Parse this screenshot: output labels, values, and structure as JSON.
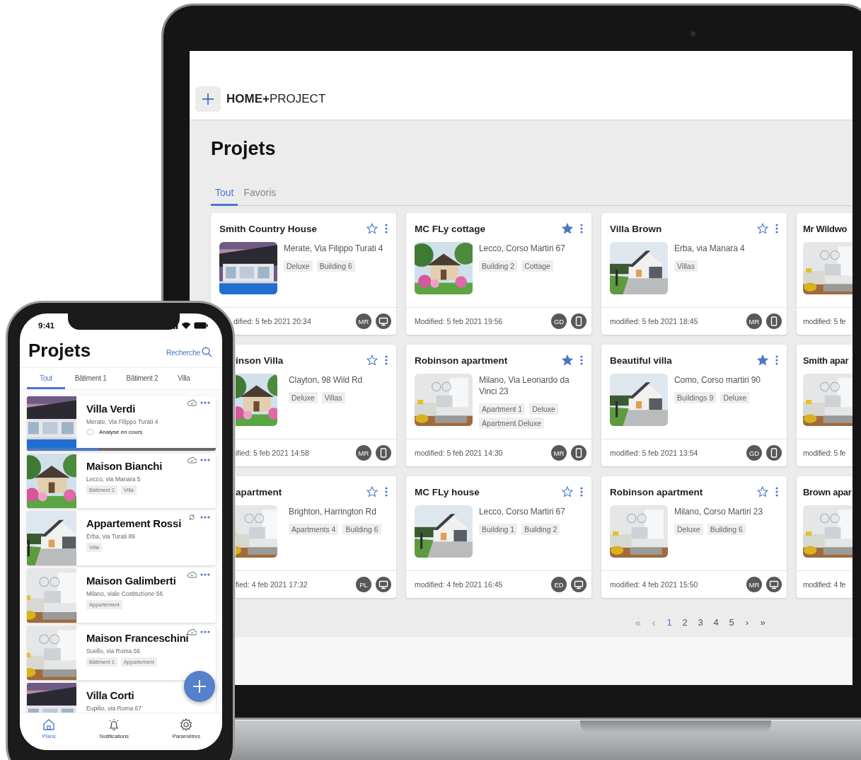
{
  "laptop": {
    "brand": "**HOME+**PROJECT",
    "page_title": "Projets",
    "tabs": [
      {
        "label": "Tout",
        "selected": true
      },
      {
        "label": "Favoris",
        "selected": false
      }
    ],
    "cards": [
      {
        "title": "Smith Country House",
        "favorite": false,
        "address": "Merate, Via Filippo Turati 4",
        "tags": [
          "Deluxe",
          "Building 6"
        ],
        "modified": "dified: 5 feb 2021 20:34",
        "avatar": "MR",
        "device": {
          "kind": "desktop"
        }
      },
      {
        "title": "MC FLy cottage",
        "favorite": true,
        "address": "Lecco, Corso Martiri 67",
        "tags": [
          "Building 2",
          "Cottage"
        ],
        "modified": "Modified: 5 feb 2021 19:56",
        "avatar": "GD",
        "device": {
          "kind": "phone"
        }
      },
      {
        "title": "Villa Brown",
        "favorite": false,
        "address": "Erba, via Manara 4",
        "tags": [
          "Villas"
        ],
        "modified": "modified: 5 feb 2021 18:45",
        "avatar": "MR",
        "device": {
          "kind": "phone"
        }
      },
      {
        "title": "Mr Wildwo",
        "modified": "modified: 5 fe"
      },
      {
        "title": "inson Villa",
        "favorite": false,
        "address": "Clayton, 98 Wild Rd",
        "tags": [
          "Deluxe",
          "Villas"
        ],
        "modified": "ified: 5 feb 2021 14:58",
        "avatar": "MR",
        "device": {
          "kind": "phone"
        }
      },
      {
        "title": "Robinson apartment",
        "favorite": true,
        "address": "Milano, Via Leonardo da Vinci 23",
        "tags": [
          "Apartment 1",
          "Deluxe",
          "Apartment Deluxe"
        ],
        "modified": "modified: 5 feb 2021 14:30",
        "avatar": "MR",
        "device": {
          "kind": "phone"
        }
      },
      {
        "title": "Beautiful villa",
        "favorite": true,
        "address": "Como, Corso martiri 90",
        "tags": [
          "Buildings 9",
          "Deluxe"
        ],
        "modified": "modified: 5 feb 2021 13:54",
        "avatar": "GD",
        "device": {
          "kind": "phone"
        }
      },
      {
        "title": "Smith apar",
        "modified": "modified: 5 fe"
      },
      {
        "title": "apartment",
        "favorite": false,
        "address": "Brighton, Harrington Rd",
        "tags": [
          "Apartments 4",
          "Building 6"
        ],
        "modified": "fied: 4 feb 2021 17:32",
        "avatar": "PL",
        "device": {
          "kind": "desktop"
        }
      },
      {
        "title": "MC FLy house",
        "favorite": false,
        "address": "Lecco, Corso Martiri 67",
        "tags": [
          "Building 1",
          "Building 2"
        ],
        "modified": "modified: 4 feb 2021 16:45",
        "avatar": "ED",
        "device": {
          "kind": "desktop"
        }
      },
      {
        "title": "Robinson apartment",
        "favorite": false,
        "address": "Milano, Corso Martiri 23",
        "tags": [
          "Deluxe",
          "Building 6"
        ],
        "modified": "modified: 4 feb 2021 15:50",
        "avatar": "MR",
        "device": {
          "kind": "desktop"
        }
      },
      {
        "title": "Brown apar",
        "modified": "modified: 4 fe"
      }
    ],
    "pagination": {
      "first": {
        "label": "«",
        "disabled": true
      },
      "previous": {
        "label": "‹",
        "disabled": true
      },
      "pages": [
        {
          "label": "1",
          "selected": true
        },
        {
          "label": "2",
          "selected": false
        },
        {
          "label": "3",
          "selected": false
        },
        {
          "label": "4",
          "selected": false
        },
        {
          "label": "5",
          "selected": false
        }
      ],
      "next": {
        "label": "›",
        "disabled": false
      },
      "last": {
        "label": "»",
        "disabled": false
      }
    }
  },
  "phone": {
    "time": "9:41",
    "title": "Projets",
    "search": "Recherche",
    "tabs": [
      {
        "label": "Tout",
        "selected": true
      },
      {
        "label": "Bâtiment 1",
        "selected": false
      },
      {
        "label": "Bâtiment 2",
        "selected": false
      },
      {
        "label": "Villa",
        "selected": false
      }
    ],
    "projects": [
      {
        "title": "Villa Verdi",
        "address": "Merate, Via Filippo Turati 4",
        "sync": {
          "kind": "cloud-check"
        },
        "status": "Analyse en cours",
        "level": 0.38
      },
      {
        "title": "Maison Bianchi",
        "address": "Lecco, via Manara 5",
        "tags": [
          "Bâtiment 2",
          "Villa"
        ],
        "sync": {
          "kind": "cloud-check"
        }
      },
      {
        "title": "Appartement Rossi",
        "address": "Erba, via Turati 89",
        "tags": [
          "Villa"
        ],
        "sync": {
          "kind": "syncing"
        }
      },
      {
        "title": "Maison Galimberti",
        "address": "Milano,  viale Costituzione 56",
        "tags": [
          "Appartement"
        ],
        "sync": {
          "kind": "cloud-error"
        }
      },
      {
        "title": "Maison Franceschini",
        "address": "Suello, via Roma 56",
        "tags": [
          "Bâtiment 1",
          "Appartement"
        ],
        "sync": {
          "kind": "cloud-check"
        }
      },
      {
        "title": "Villa Corti",
        "address": "Eupilio, via Roma 67"
      }
    ],
    "nav": [
      {
        "label": "Plans",
        "kind": "home",
        "selected": true
      },
      {
        "label": "Notifications",
        "kind": "bell",
        "selected": false
      },
      {
        "label": "Paramètres",
        "kind": "gear",
        "selected": false
      }
    ]
  }
}
